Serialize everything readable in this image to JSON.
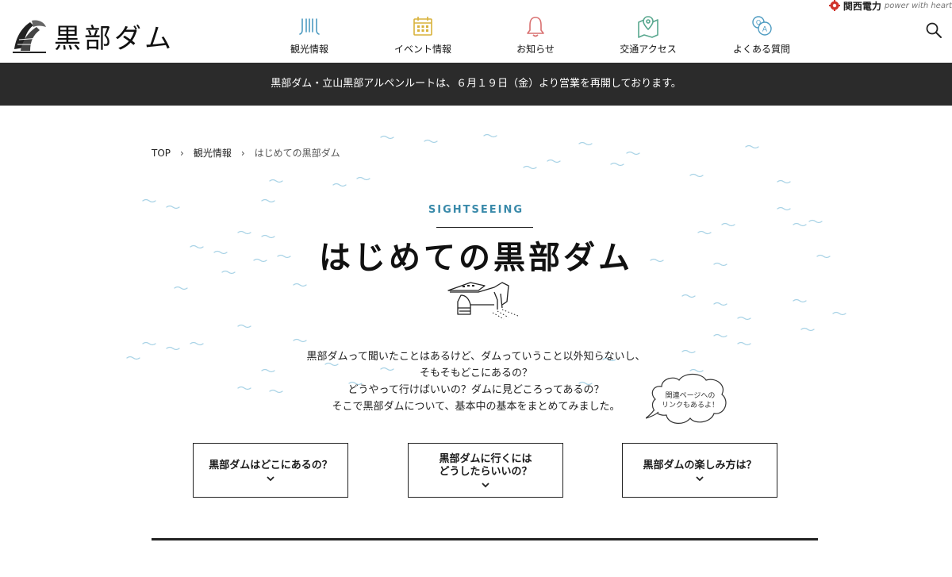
{
  "header": {
    "logo_text": "黒部ダム",
    "nav": [
      {
        "label": "観光情報",
        "icon": "sightseeing-icon"
      },
      {
        "label": "イベント情報",
        "icon": "calendar-icon"
      },
      {
        "label": "お知らせ",
        "icon": "bell-icon"
      },
      {
        "label": "交通アクセス",
        "icon": "map-pin-icon"
      },
      {
        "label": "よくある質問",
        "icon": "faq-icon"
      }
    ],
    "kansai": {
      "name": "関西電力",
      "tagline": "power with heart"
    },
    "search_icon": "search-icon"
  },
  "notice": {
    "text": "黒部ダム・立山黒部アルペンルートは、６月１９日（金）より営業を再開しております。"
  },
  "breadcrumb": {
    "items": [
      "TOP",
      "観光情報"
    ],
    "separator": "›",
    "current": "はじめての黒部ダム"
  },
  "hero": {
    "eyebrow": "SIGHTSEEING",
    "title": "はじめての黒部ダム",
    "intro": [
      "黒部ダムって聞いたことはあるけど、ダムっていうこと以外知らないし、",
      "そもそもどこにあるの？",
      "どうやって行けばいいの？ダムに見どころってあるの？",
      "そこで黒部ダムについて、基本中の基本をまとめてみました。"
    ],
    "bubble": {
      "line1": "関連ページへの",
      "line2": "リンクもあるよ！"
    }
  },
  "cards": [
    {
      "label": "黒部ダムはどこにあるの？"
    },
    {
      "label": "黒部ダムに行くには\nどうしたらいいの？"
    },
    {
      "label": "黒部ダムの楽しみ方は？"
    }
  ],
  "colors": {
    "accent": "#3a8aaa",
    "notice_bg": "#2b2b2b",
    "wave": "#a9d3e6",
    "icon_blue": "#4d9bc1",
    "icon_yellow": "#d8b23a",
    "icon_red": "#d97070",
    "icon_green": "#59a88f",
    "brand_red": "#d0342c"
  }
}
